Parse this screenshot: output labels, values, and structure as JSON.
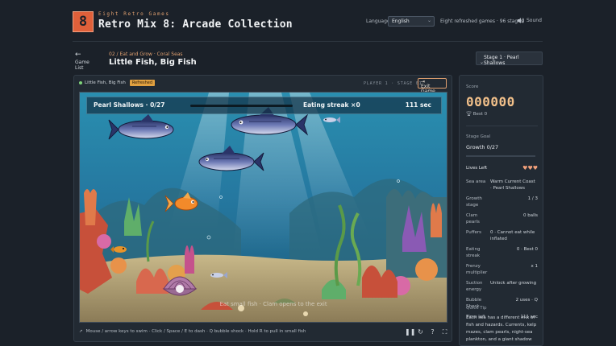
{
  "header": {
    "logo_text": "8",
    "tagline": "Eight Retro Games",
    "title": "Retro Mix 8: Arcade Collection",
    "language_label": "Language",
    "language_value": "English",
    "info": "Eight refreshed games · 96 stages",
    "sound_label": "Sound"
  },
  "nav": {
    "back_label": "Game List",
    "breadcrumb": "02 / Eat and Grow · Coral Seas",
    "level_title": "Little Fish, Big Fish",
    "stage_select": "Stage 1 · Pearl Shallows"
  },
  "game": {
    "name": "Little Fish, Big Fish",
    "badge": "Refreshed",
    "player_stage": "PLAYER 1 · STAGE 01",
    "exit_label": "Exit Game",
    "hud": {
      "stage_progress": "Pearl Shallows · 0/27",
      "progress_fraction": 0.0,
      "streak": "Eating streak ×0",
      "timer": "111 sec"
    },
    "overlay_hint": "Eat small fish · Clam opens to the exit",
    "controls_hint": "Mouse / arrow keys to swim · Click / Space / E to dash · Q bubble shock · Hold R to pull in small fish",
    "control_icons": [
      "pause-icon",
      "restart-icon",
      "help-icon",
      "fullscreen-icon"
    ]
  },
  "sidebar": {
    "score_label": "Score",
    "score": "000000",
    "best": "Best 0",
    "goal_label": "Stage Goal",
    "goal_value": "Growth 0/27",
    "goal_fraction": 0.0,
    "lives_label": "Lives Left",
    "lives": "♥♥♥",
    "stats": [
      {
        "k": "Sea area",
        "v": "Warm Current Coast · Pearl Shallows",
        "align": "left"
      },
      {
        "k": "Growth stage",
        "v": "1 / 3"
      },
      {
        "k": "Clam pearls",
        "v": "0 balls"
      },
      {
        "k": "Puffers",
        "v": "0 · Cannot eat while inflated",
        "align": "left"
      },
      {
        "k": "Eating streak",
        "v": "0 · Best 0"
      },
      {
        "k": "Frenzy multiplier",
        "v": "x 1"
      },
      {
        "k": "Suction energy",
        "v": "Unlock after growing",
        "align": "left"
      },
      {
        "k": "Bubble Shock",
        "v": "2 uses · Q"
      },
      {
        "k": "Time left",
        "v": "111 sec"
      }
    ],
    "tip_label": "Quick Tip",
    "tip": "Each sea has a different mix of fish and hazards. Currents, kelp mazes, clam pearls, night-sea plankton, and a giant shadow"
  },
  "colors": {
    "accent": "#e0603a",
    "score": "#f2c08a",
    "background": "#1b2129"
  }
}
